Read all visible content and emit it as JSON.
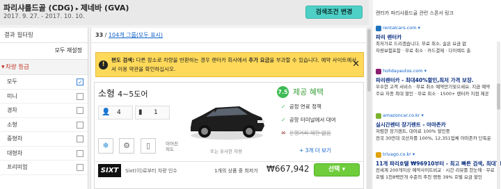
{
  "header": {
    "origin": "파리샤를드골 (CDG)",
    "separator": "▸",
    "destination": "제네바 (GVA)",
    "dates": "2017. 9. 27. - 2017. 10. 10.",
    "modify_button": "검색조건 변경"
  },
  "sidebar": {
    "title": "결과 필터링",
    "reset": "모두 재설정",
    "section": "차량 등급",
    "options": [
      {
        "label": "모두",
        "checked": true
      },
      {
        "label": "미니",
        "checked": false
      },
      {
        "label": "경차",
        "checked": false
      },
      {
        "label": "소형",
        "checked": false
      },
      {
        "label": "중형차",
        "checked": false
      },
      {
        "label": "대형차",
        "checked": false
      },
      {
        "label": "프리미엄",
        "checked": false
      }
    ]
  },
  "results": {
    "count": "33",
    "sep": " / ",
    "groups_link": "104개 그룹(모두 표시)"
  },
  "notice": {
    "icon": "!",
    "label": "편도 검색:",
    "text1": " 다른 장소로 차량을 반환하는 경우 렌터카 회사에서 ",
    "bold": "추가 요금",
    "text2": "을 부과할 수 있습니다. 예약 사이트에서 서 이용 약관을 확인하십시오.",
    "close": "✕"
  },
  "card": {
    "class": "소형",
    "doors": "4~5도어",
    "seats": "4",
    "bags": "1",
    "door_label": "이어진 저도",
    "caption": "또는 유사한 차량",
    "score": "7.5",
    "benefits_title": "제공 혜택",
    "benefits": [
      {
        "text": "공정 연료 정책",
        "ok": true
      },
      {
        "text": "공항 터미널에서 대여",
        "ok": true
      },
      {
        "text": "운행거리 제한 없음",
        "ok": false
      }
    ],
    "more": "+ 3개 더 보기",
    "vendor_logo": "SIXT",
    "vendor_text": "Sixt(이)로부터 차량 인수",
    "price_label": "1개의 상품 중 최저가",
    "price": "₩667,942",
    "select_button": "선택 ▾"
  },
  "ads": {
    "heading": "렌터카 파리샤를드골 관련 스폰서 링크",
    "items": [
      {
        "domain": "rentalcars.com ▾",
        "fav_color": "#1e73be",
        "title": "파리 렌터카",
        "lines": [
          "최저가로 드리겠습니다. 무료 취소, 숨은 요금 없",
          "차량보험포함 · 무료 취소 · 카드결제 · 다이렉트 출"
        ]
      },
      {
        "domain": "holidayautos.com ▾",
        "fav_color": "#8a1d6e",
        "title": "파리렌터카 - 최대40%할인,최저 가격 보장.",
        "lines": [
          "우수한 고객 서비스 · 무료 취소 예약만기잊으세요. 지금 예약",
          "주요 차종 최대 할인 · 무료 취소 · 1500+ 렌터카 지점 제공"
        ]
      },
      {
        "domain": "amazoncar.co.kr ▾",
        "fav_color": "#7bb32e",
        "title": "실시간렌터 장기렌트 - 아마존카",
        "lines": [
          "저렴한 장기렌트, 대여료 100% 할인중",
          "전국 30만대 국산차를 100%, 12,351업체 아마존카 단독운"
        ]
      },
      {
        "domain": "trivago.co.kr ▾",
        "fav_color": "#e0a20d",
        "title": "11개 파리호텔 ₩96910부터 - 최고 빠른 검색, 최대78%할인",
        "lines": [
          "전세계 200개이상 예약사이트비교 · 시간 리뷰를 한눈에 · 무료",
          "호텔 1천8백만개 수준의 추천 평등 39% 호텔 요금 할인"
        ]
      }
    ]
  }
}
